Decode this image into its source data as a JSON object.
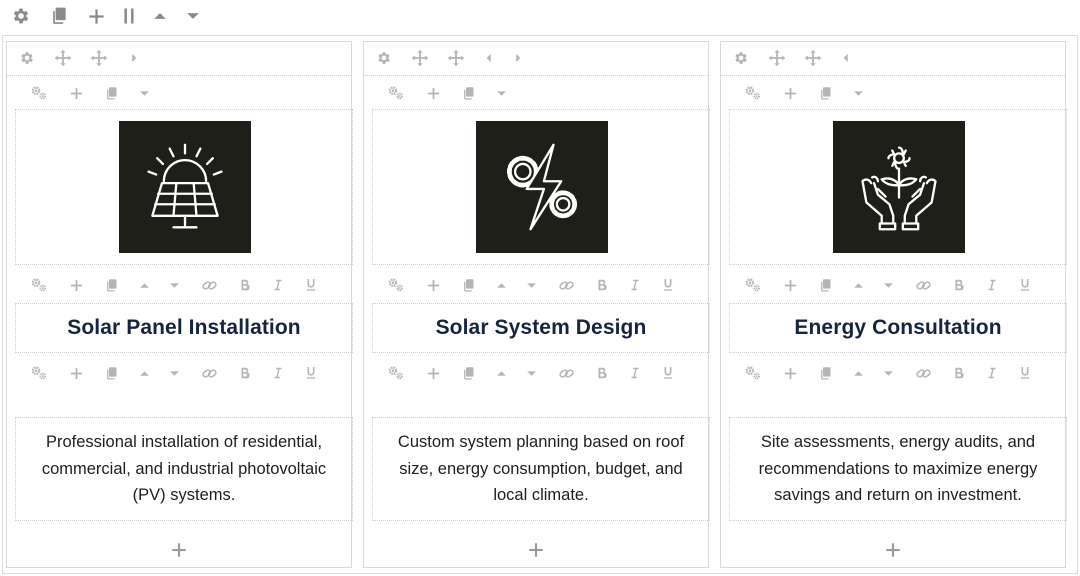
{
  "top_toolbar": {
    "icons": [
      "gear-icon",
      "copy-icon",
      "plus-icon",
      "columns-icon",
      "caret-up-icon",
      "caret-down-icon"
    ]
  },
  "colors": {
    "icon_box_bg": "#1f1f1a",
    "title_color": "#16253f",
    "toolbar_icon": "#b5b5b5",
    "top_icon": "#8a8a8a"
  },
  "columns": [
    {
      "icon": "solar-panel-icon",
      "title": "Solar Panel Installation",
      "text": "Professional installation of residential, commercial, and industrial photovoltaic (PV) systems."
    },
    {
      "icon": "gears-lightning-icon",
      "title": "Solar System Design",
      "text": "Custom system planning based on roof size, energy consumption, budget, and local climate."
    },
    {
      "icon": "hands-flower-icon",
      "title": "Energy Consultation",
      "text": "Site assessments, energy audits, and recommendations to maximize energy savings and return on investment."
    }
  ]
}
